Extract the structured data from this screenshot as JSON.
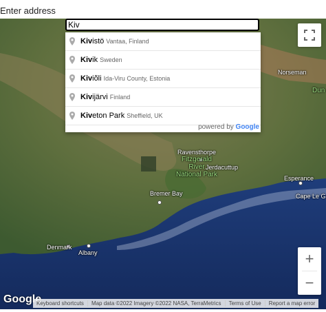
{
  "label": "Enter address",
  "search": {
    "value": "Kiv"
  },
  "suggestions": [
    {
      "bold": "Kiv",
      "rest": "istö",
      "secondary": "Vantaa, Finland"
    },
    {
      "bold": "Kiv",
      "rest": "ik",
      "secondary": "Sweden"
    },
    {
      "bold": "Kiv",
      "rest": "iõli",
      "secondary": "Ida-Viru County, Estonia"
    },
    {
      "bold": "Kiv",
      "rest": "ijärvi",
      "secondary": "Finland"
    },
    {
      "bold": "Kiv",
      "rest": "eton Park",
      "secondary": "Sheffield, UK"
    }
  ],
  "powered_by": {
    "prefix": "powered by",
    "brand": "Google"
  },
  "map_labels": {
    "norseman": "Norseman",
    "dun": "Dun",
    "ravensthorpe": "Ravensthorpe",
    "jerdacuttup": "Jerdacuttup",
    "esperance": "Esperance",
    "cape_le": "Cape Le G",
    "park_line1": "Fitzgerald",
    "park_line2": "River",
    "park_line3": "National Park",
    "bremer_bay": "Bremer Bay",
    "denmark": "Denmark",
    "albany": "Albany"
  },
  "controls": {
    "zoom_in": "+",
    "zoom_out": "−"
  },
  "logo": "Google",
  "footer": {
    "shortcuts": "Keyboard shortcuts",
    "map_data": "Map data ©2022 Imagery ©2022 NASA, TerraMetrics",
    "terms": "Terms of Use",
    "report": "Report a map error"
  },
  "colors": {
    "ocean": "#1e3a78",
    "land": "#6b7b4a",
    "park_green": "#9bdc7f",
    "google_blue": "#4285f4"
  },
  "icons": {
    "fullscreen": "fullscreen-icon",
    "pin": "pin-icon"
  }
}
